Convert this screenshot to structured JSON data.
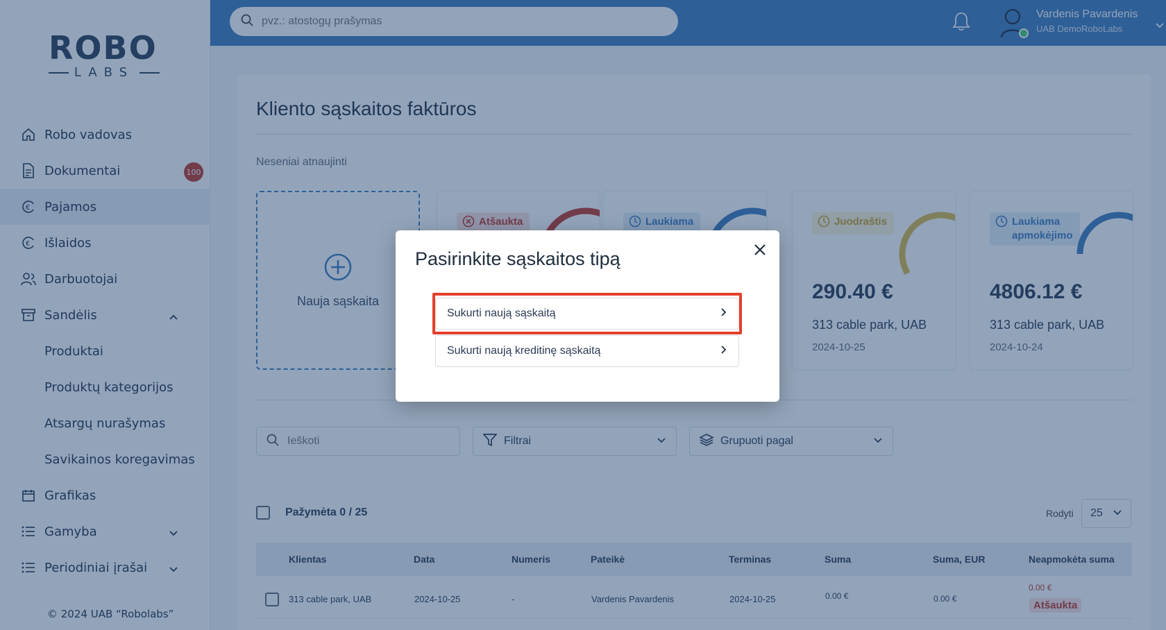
{
  "sidebar": {
    "logo_top": "ROBO",
    "logo_bottom": "LABS",
    "items": [
      {
        "label": "Robo vadovas",
        "icon": "home-icon"
      },
      {
        "label": "Dokumentai",
        "icon": "document-icon",
        "badge": "100"
      },
      {
        "label": "Pajamos",
        "icon": "euro-circle-icon",
        "active": true
      },
      {
        "label": "Išlaidos",
        "icon": "euro-circle-icon"
      },
      {
        "label": "Darbuotojai",
        "icon": "users-icon"
      },
      {
        "label": "Sandėlis",
        "icon": "archive-icon",
        "expanded": true
      },
      {
        "label": "Produktai",
        "sub": true
      },
      {
        "label": "Produktų kategorijos",
        "sub": true
      },
      {
        "label": "Atsargų nurašymas",
        "sub": true
      },
      {
        "label": "Savikainos koregavimas",
        "sub": true
      },
      {
        "label": "Grafikas",
        "icon": "calendar-icon"
      },
      {
        "label": "Gamyba",
        "icon": "list-icon"
      },
      {
        "label": "Periodiniai įrašai",
        "icon": "list-icon"
      }
    ],
    "copyright": "© 2024 UAB “Robolabs”"
  },
  "topbar": {
    "search_placeholder": "pvz.: atostogų prašymas",
    "user_name": "Vardenis Pavardenis",
    "user_company": "UAB DemoRoboLabs"
  },
  "main": {
    "title": "Kliento sąskaitos faktūros",
    "recent_label": "Neseniai atnaujinti",
    "new_invoice_label": "Nauja sąskaita",
    "cards": [
      {
        "status": "Atšaukta",
        "status_color": "#c0392b",
        "status_bg": "#fbe3e1",
        "ring_color": "#c0392b"
      },
      {
        "status": "Laukiama",
        "status_color": "#3f7bbd",
        "status_bg": "#e3edf8",
        "ring_color": "#3f7bbd"
      },
      {
        "status": "Juodraštis",
        "status_color": "#c9a227",
        "status_bg": "#fbf3d9",
        "ring_color": "#d8b84a",
        "amount": "290.40 €",
        "client": "313 cable park, UAB",
        "date": "2024-10-25"
      },
      {
        "status_line1": "Laukiama",
        "status_line2": "apmokėjimo",
        "status_color": "#3f7bbd",
        "status_bg": "#e3edf8",
        "ring_color": "#3f7bbd",
        "amount": "4806.12 €",
        "client": "313 cable park, UAB",
        "date": "2024-10-24"
      }
    ],
    "search_placeholder": "Ieškoti",
    "filters_label": "Filtrai",
    "group_label": "Grupuoti pagal",
    "selected_label": "Pažymėta 0 / 25",
    "show_label": "Rodyti",
    "show_value": "25",
    "columns": [
      "Klientas",
      "Data",
      "Numeris",
      "Pateikė",
      "Terminas",
      "Suma",
      "Suma, EUR",
      "Neapmokėta suma"
    ],
    "row": {
      "client": "313 cable park, UAB",
      "date": "2024-10-25",
      "number": "-",
      "submitted_by": "Vardenis Pavardenis",
      "due": "2024-10-25",
      "sum": "0.00 €",
      "sum_eur": "0.00 €",
      "unpaid": "0.00 €",
      "status": "Atšaukta"
    }
  },
  "modal": {
    "title": "Pasirinkite sąskaitos tipą",
    "option1": "Sukurti naują sąskaitą",
    "option2": "Sukurti naują kreditinę sąskaitą",
    "highlight_color": "#e3402b"
  }
}
